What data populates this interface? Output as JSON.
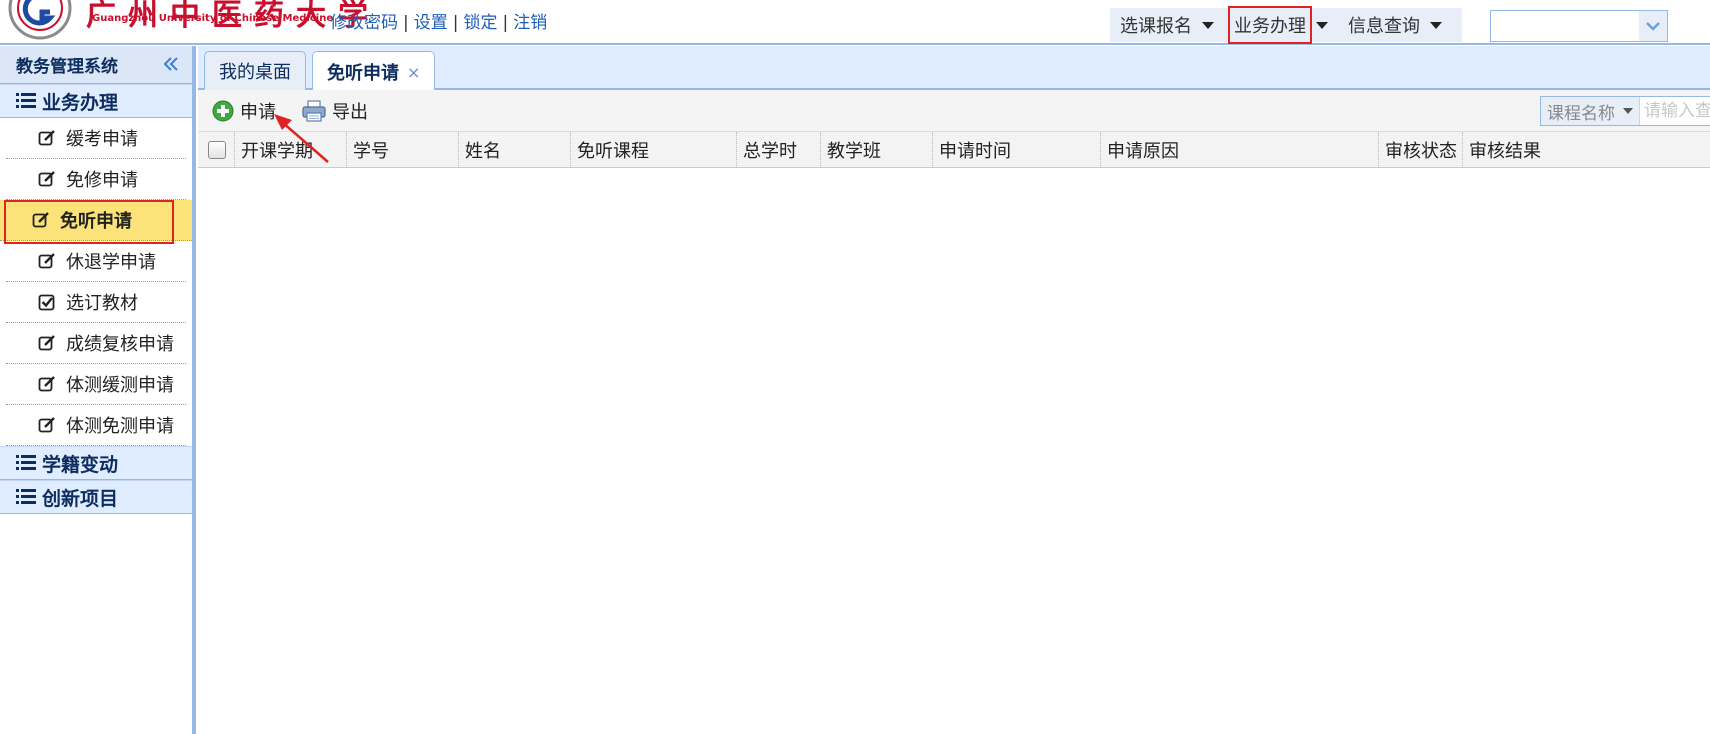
{
  "header": {
    "logo_cn": "广州中医药大学",
    "logo_en": "Guangzhou University of Chinese Medicine",
    "user_links": [
      "修改密码",
      "设置",
      "锁定",
      "注销"
    ],
    "user_links_sep": "|",
    "nav_items": [
      {
        "label": "选课报名",
        "highlighted": false
      },
      {
        "label": "业务办理",
        "highlighted": true
      },
      {
        "label": "信息查询",
        "highlighted": false
      }
    ],
    "select_value": ""
  },
  "sidebar": {
    "title": "教务管理系统",
    "sections": [
      {
        "label": "业务办理",
        "items": [
          {
            "label": "缓考申请",
            "icon": "edit-icon",
            "active": false
          },
          {
            "label": "免修申请",
            "icon": "edit-icon",
            "active": false
          },
          {
            "label": "免听申请",
            "icon": "edit-icon",
            "active": true
          },
          {
            "label": "休退学申请",
            "icon": "edit-icon",
            "active": false
          },
          {
            "label": "选订教材",
            "icon": "checkbox-icon",
            "active": false
          },
          {
            "label": "成绩复核申请",
            "icon": "edit-icon",
            "active": false
          },
          {
            "label": "体测缓测申请",
            "icon": "edit-icon",
            "active": false
          },
          {
            "label": "体测免测申请",
            "icon": "edit-icon",
            "active": false
          }
        ]
      },
      {
        "label": "学籍变动",
        "items": []
      },
      {
        "label": "创新项目",
        "items": []
      }
    ]
  },
  "tabs": [
    {
      "label": "我的桌面",
      "active": false,
      "closable": false
    },
    {
      "label": "免听申请",
      "active": true,
      "closable": true,
      "close_glyph": "×"
    }
  ],
  "toolbar": {
    "apply_label": "申请",
    "export_label": "导出",
    "search_field": "课程名称",
    "search_placeholder": "请输入查询条件"
  },
  "grid": {
    "columns": [
      "开课学期",
      "学号",
      "姓名",
      "免听课程",
      "总学时",
      "教学班",
      "申请时间",
      "申请原因",
      "审核状态",
      "审核结果"
    ],
    "rows": []
  },
  "colors": {
    "accent_border": "#95b8e7",
    "active_menu_bg": "#fbe37a",
    "highlight_red": "#e02222",
    "brand_red": "#c8102e",
    "link_blue": "#1f5fb6"
  }
}
